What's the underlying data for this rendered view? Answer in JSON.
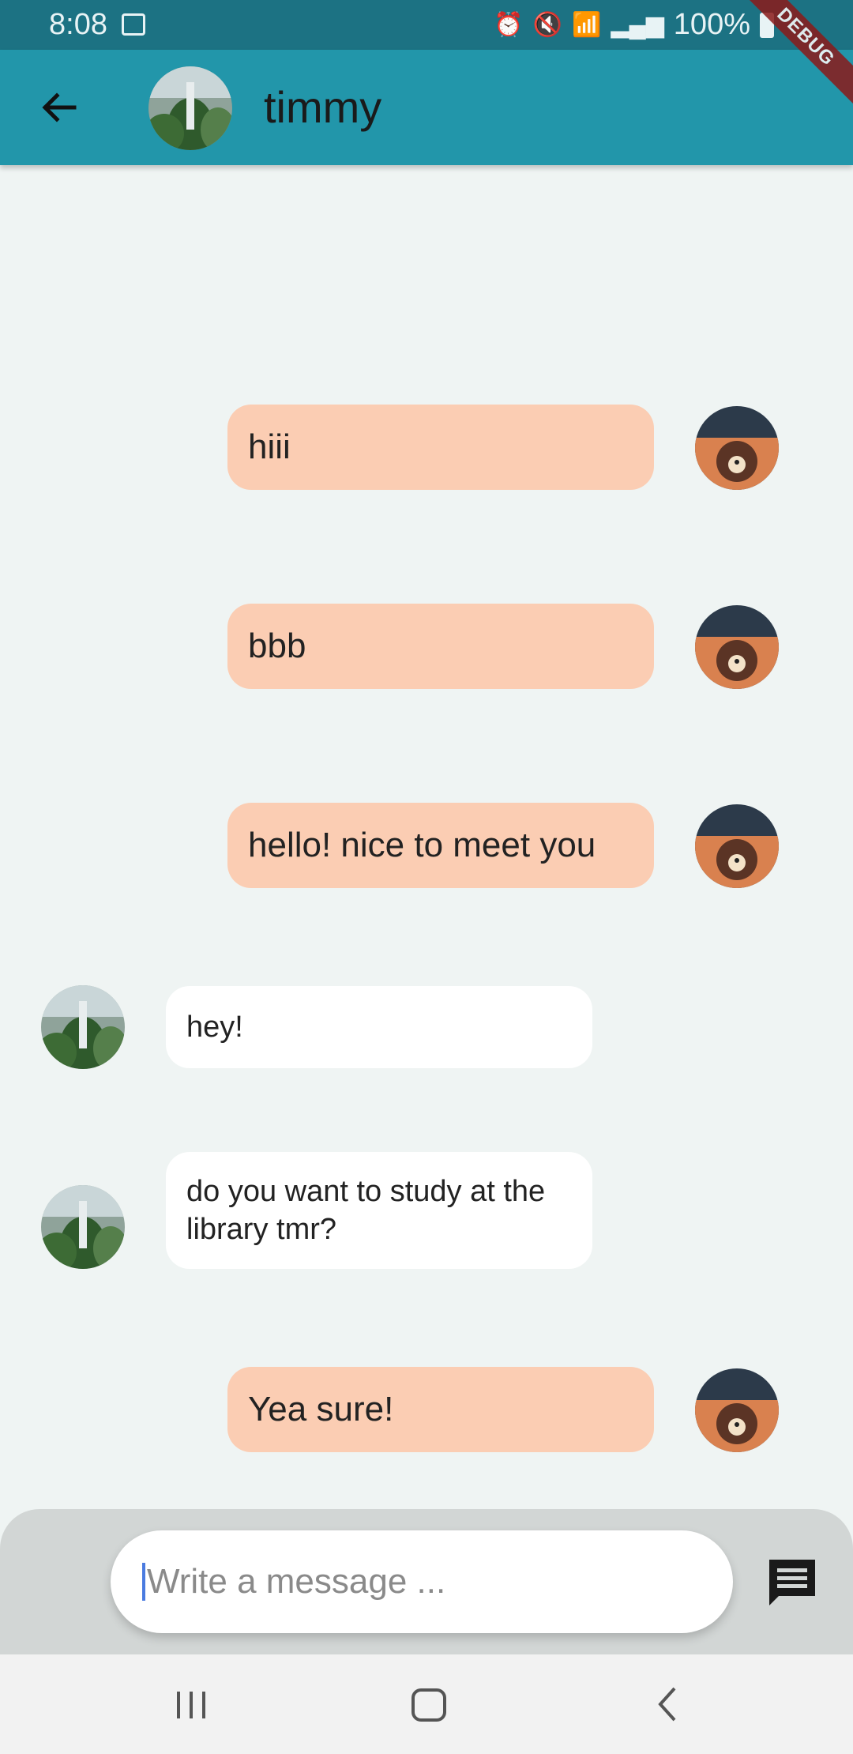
{
  "status_bar": {
    "time": "8:08",
    "battery": "100%"
  },
  "debug_banner": "DEBUG",
  "header": {
    "title": "timmy"
  },
  "messages": [
    {
      "side": "sent",
      "text": "hiii"
    },
    {
      "side": "sent",
      "text": "bbb"
    },
    {
      "side": "sent",
      "text": "hello! nice to meet you"
    },
    {
      "side": "received",
      "text": "hey!"
    },
    {
      "side": "received",
      "text": "do you want to study at the library tmr?"
    },
    {
      "side": "sent",
      "text": "Yea sure!"
    }
  ],
  "composer": {
    "placeholder": "Write a message ..."
  },
  "icons": {
    "back": "arrow-left-icon",
    "send": "message-icon",
    "nav_recents": "recents-icon",
    "nav_home": "home-icon",
    "nav_back": "back-chevron-icon"
  },
  "colors": {
    "status_bar": "#1C7283",
    "app_bar": "#2296AA",
    "background": "#EFF4F3",
    "sent_bubble": "#FBCDB3",
    "received_bubble": "#FFFFFF",
    "composer_bg": "#D2D6D5"
  }
}
